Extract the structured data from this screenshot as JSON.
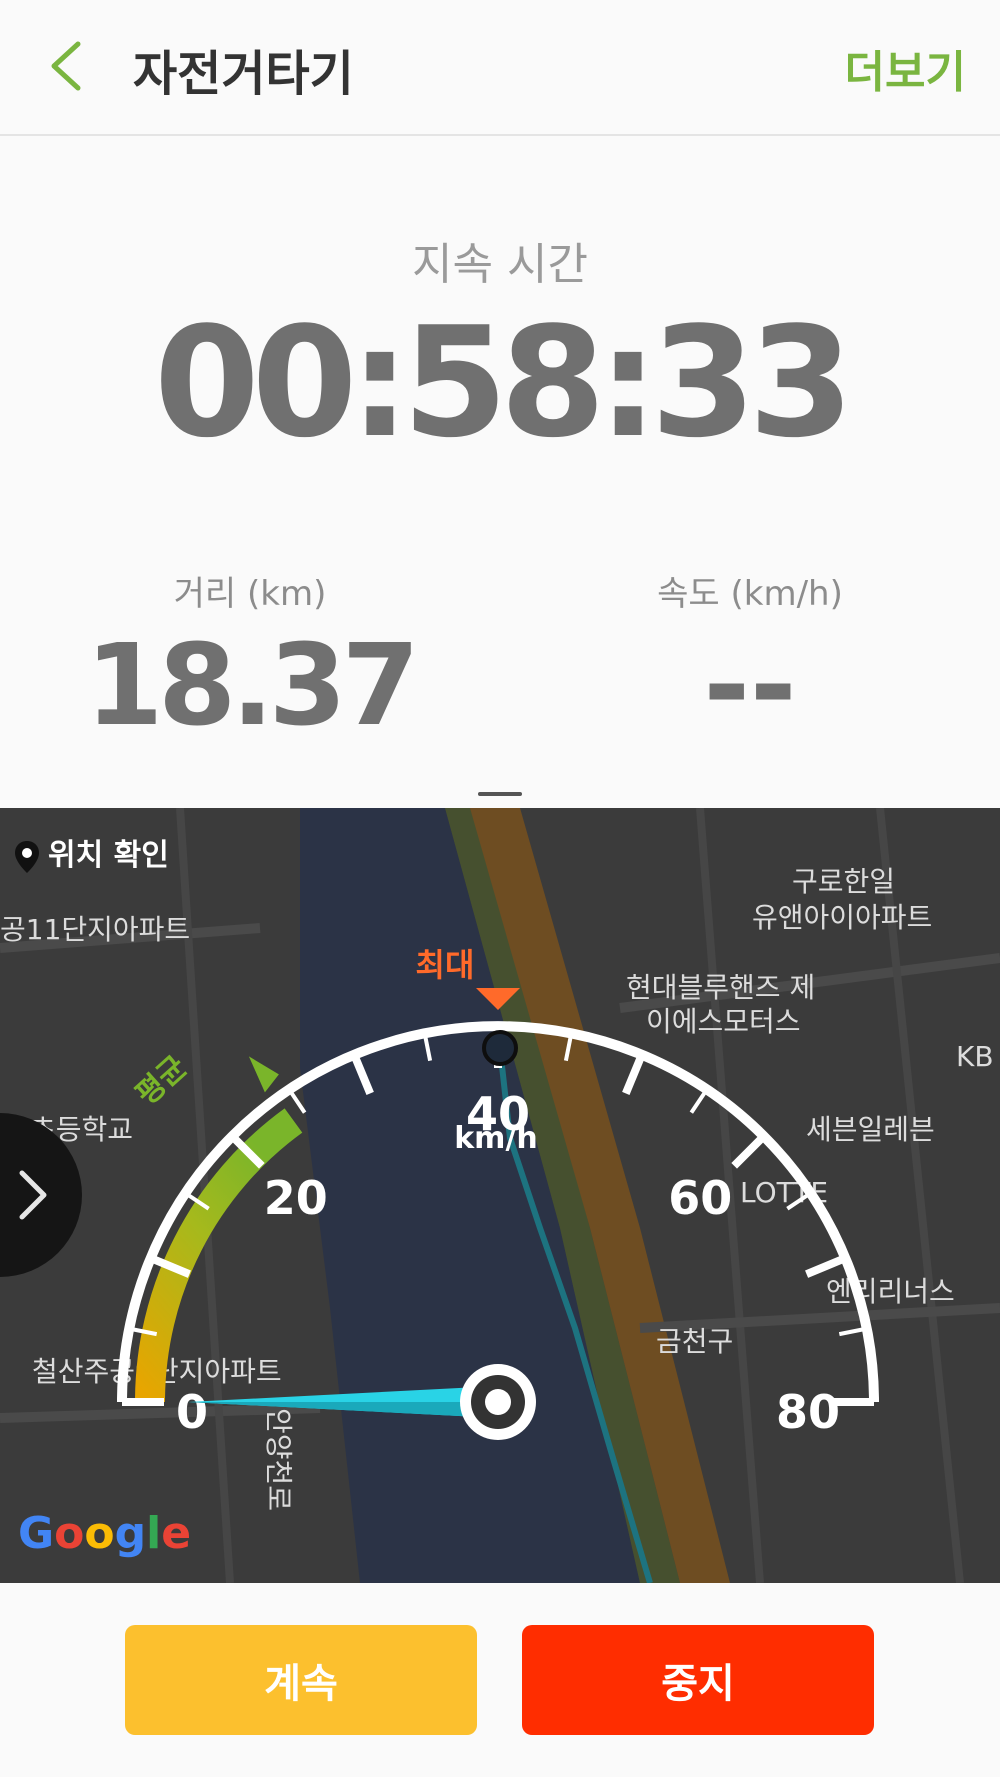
{
  "header": {
    "title": "자전거타기",
    "more_label": "더보기",
    "back_icon": "chevron-left-icon"
  },
  "stats": {
    "duration_label": "지속 시간",
    "duration_value": "00:58:33",
    "distance_label": "거리 (km)",
    "distance_value": "18.37",
    "speed_label": "속도 (km/h)",
    "speed_value": "--"
  },
  "map": {
    "location_check": "위치 확인",
    "labels": [
      "구로한일",
      "유앤아이아파트",
      "공11단지아파트",
      "현대블루핸즈 제",
      "이에스모터스",
      "세븐일레븐",
      "LOTTE",
      "엔리리너스",
      "금천구",
      "철산주공9단지아파트",
      "안양천로",
      "초등학교",
      "KB"
    ],
    "google_logo": "Google"
  },
  "gauge": {
    "unit": "km/h",
    "ticks": [
      "0",
      "20",
      "40",
      "60",
      "80"
    ],
    "max_label": "최대",
    "avg_label": "평균",
    "current_speed": 0,
    "max_speed": 40,
    "min": 0,
    "max": 80
  },
  "buttons": {
    "continue": "계속",
    "stop": "중지"
  },
  "colors": {
    "accent": "#7ab540",
    "continue": "#fcc02e",
    "stop": "#ff2d00",
    "needle": "#29d3e6",
    "max_marker": "#ff6a2a"
  }
}
